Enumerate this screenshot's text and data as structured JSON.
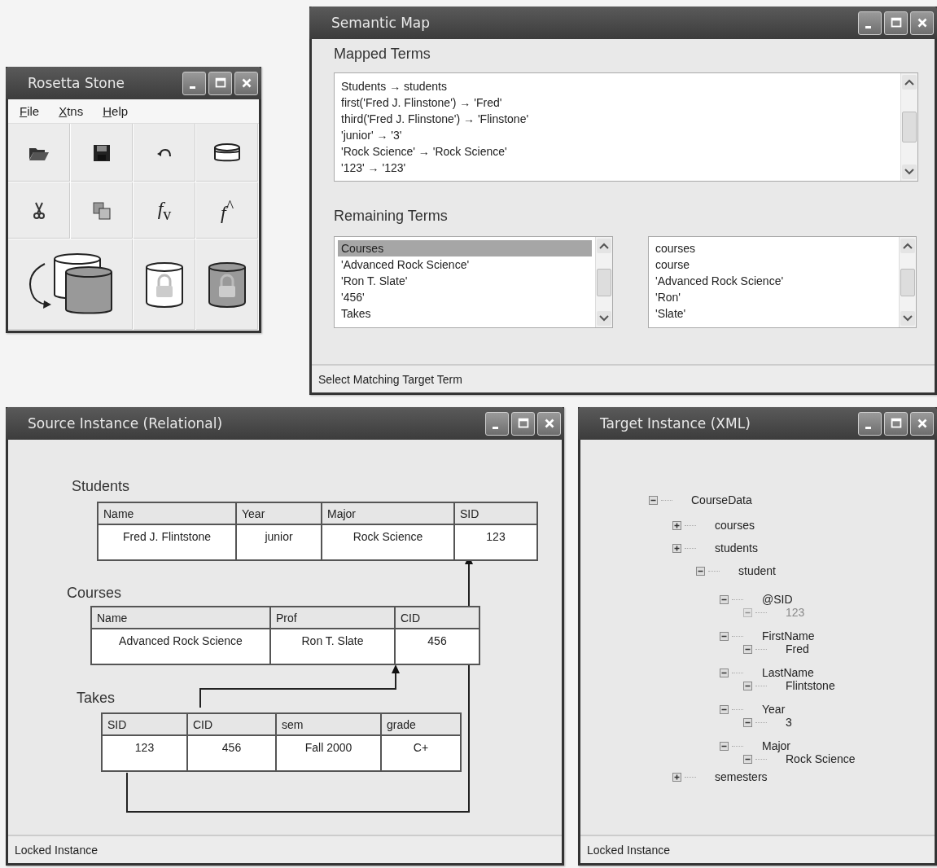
{
  "rosetta": {
    "title": "Rosetta Stone",
    "menu": [
      "File",
      "Xtns",
      "Help"
    ],
    "tools": [
      {
        "kind": "folder"
      },
      {
        "kind": "floppy"
      },
      {
        "kind": "undo"
      },
      {
        "kind": "database"
      },
      {
        "kind": "scissors"
      },
      {
        "kind": "copy"
      },
      {
        "kind": "formula",
        "label": "*f*$_{v}$"
      },
      {
        "kind": "formula",
        "label": "*f*$^{^}$"
      },
      {
        "kind": "convert"
      },
      {
        "kind": "locked-light"
      },
      {
        "kind": "locked-dark"
      }
    ]
  },
  "semantic": {
    "title": "Semantic Map",
    "mapped_label": "Mapped Terms",
    "mapped_terms": [
      "Students → students",
      "first('Fred J. Flinstone') → 'Fred'",
      "third('Fred J. Flinstone') → 'Flinstone'",
      "'junior' → '3'",
      "'Rock Science' → 'Rock Science'",
      "'123' → '123'"
    ],
    "remaining_label": "Remaining Terms",
    "source_terms": [
      {
        "text": "Courses",
        "selected": true
      },
      {
        "text": "'Advanced Rock Science'",
        "selected": false
      },
      {
        "text": "'Ron T. Slate'",
        "selected": false
      },
      {
        "text": "'456'",
        "selected": false
      },
      {
        "text": "Takes",
        "selected": false
      }
    ],
    "target_terms": [
      {
        "text": "courses",
        "selected": false
      },
      {
        "text": "course",
        "selected": false
      },
      {
        "text": "'Advanced Rock Science'",
        "selected": false
      },
      {
        "text": "'Ron'",
        "selected": false
      },
      {
        "text": "'Slate'",
        "selected": false
      }
    ],
    "status": "Select Matching Target Term"
  },
  "source": {
    "title": "Source Instance (Relational)",
    "tables": [
      {
        "name": "Students",
        "columns": [
          "Name",
          "Year",
          "Major",
          "SID"
        ],
        "rows": [
          [
            "Fred J. Flintstone",
            "junior",
            "Rock Science",
            "123"
          ]
        ]
      },
      {
        "name": "Courses",
        "columns": [
          "Name",
          "Prof",
          "CID"
        ],
        "rows": [
          [
            "Advanced Rock Science",
            "Ron T. Slate",
            "456"
          ]
        ]
      },
      {
        "name": "Takes",
        "columns": [
          "SID",
          "CID",
          "sem",
          "grade"
        ],
        "rows": [
          [
            "123",
            "456",
            "Fall 2000",
            "C+"
          ]
        ]
      }
    ],
    "status": "Locked Instance"
  },
  "target": {
    "title": "Target Instance (XML)",
    "tree": {
      "label": "CourseData",
      "expanded": true,
      "children": [
        {
          "label": "courses",
          "expanded": false
        },
        {
          "label": "students",
          "expanded": false,
          "children": [
            {
              "label": "student",
              "expanded": true,
              "children": [
                {
                  "label": "@SID",
                  "expanded": true,
                  "children": [
                    {
                      "label": "123",
                      "expanded": true,
                      "disabled": true
                    }
                  ]
                },
                {
                  "label": "FirstName",
                  "expanded": true,
                  "children": [
                    {
                      "label": "Fred",
                      "expanded": true,
                      "disabled": false
                    }
                  ]
                },
                {
                  "label": "LastName",
                  "expanded": true,
                  "children": [
                    {
                      "label": "Flintstone",
                      "expanded": true,
                      "disabled": false
                    }
                  ]
                },
                {
                  "label": "Year",
                  "expanded": true,
                  "children": [
                    {
                      "label": "3",
                      "expanded": true,
                      "disabled": false
                    }
                  ]
                },
                {
                  "label": "Major",
                  "expanded": true,
                  "children": [
                    {
                      "label": "Rock Science",
                      "expanded": true,
                      "disabled": false
                    }
                  ]
                }
              ]
            }
          ]
        },
        {
          "label": "semesters",
          "expanded": false
        }
      ]
    },
    "status": "Locked Instance"
  }
}
